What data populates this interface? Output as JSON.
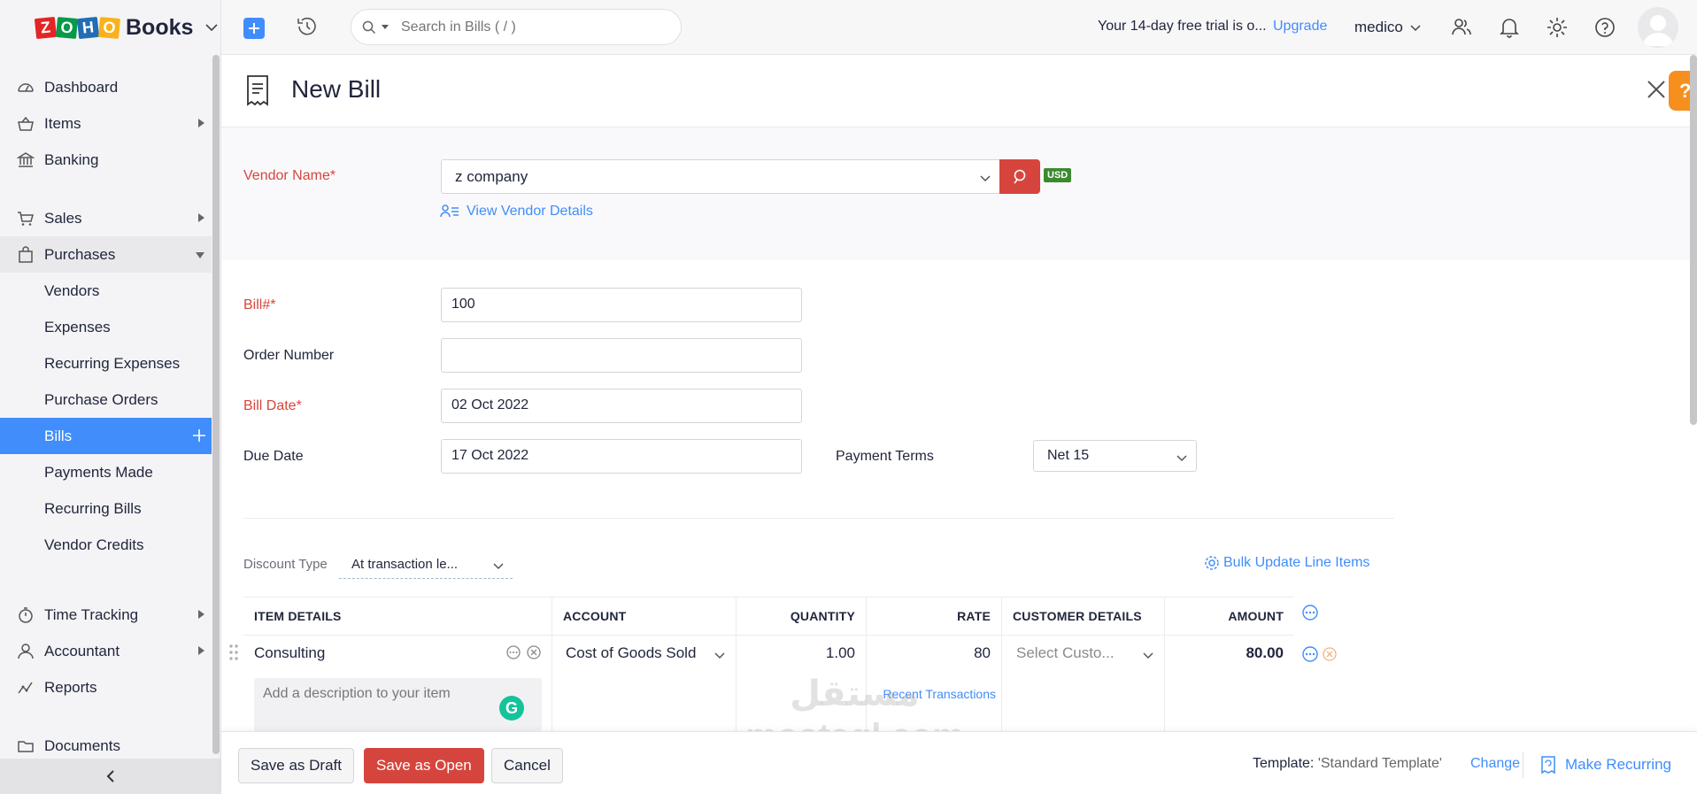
{
  "app": {
    "brand": "Books",
    "logo_letters": [
      "Z",
      "O",
      "H",
      "O"
    ],
    "logo_colors": [
      "#e42527",
      "#089949",
      "#226db4",
      "#f9b21d"
    ]
  },
  "header": {
    "search_placeholder": "Search in Bills ( / )",
    "trial_text": "Your 14-day free trial is o...",
    "upgrade_label": "Upgrade",
    "org_name": "medico"
  },
  "sidebar": {
    "dashboard": "Dashboard",
    "items": "Items",
    "banking": "Banking",
    "sales": "Sales",
    "purchases": "Purchases",
    "vendors": "Vendors",
    "expenses": "Expenses",
    "recurring_expenses": "Recurring Expenses",
    "purchase_orders": "Purchase Orders",
    "bills": "Bills",
    "payments_made": "Payments Made",
    "recurring_bills": "Recurring Bills",
    "vendor_credits": "Vendor Credits",
    "time_tracking": "Time Tracking",
    "accountant": "Accountant",
    "reports": "Reports",
    "documents": "Documents"
  },
  "page": {
    "title": "New Bill",
    "help": "?"
  },
  "form": {
    "vendor_label": "Vendor Name*",
    "vendor_value": "z company",
    "currency": "USD",
    "view_vendor": "View Vendor Details",
    "bill_no_label": "Bill#*",
    "bill_no_value": "100",
    "order_label": "Order Number",
    "order_value": "",
    "bill_date_label": "Bill Date*",
    "bill_date_value": "02 Oct 2022",
    "due_date_label": "Due Date",
    "due_date_value": "17 Oct 2022",
    "payment_terms_label": "Payment Terms",
    "payment_terms_value": "Net 15",
    "discount_label": "Discount Type",
    "discount_value": "At transaction le...",
    "bulk_update": "Bulk Update Line Items"
  },
  "table": {
    "headers": {
      "item": "ITEM DETAILS",
      "account": "ACCOUNT",
      "quantity": "QUANTITY",
      "rate": "RATE",
      "customer": "CUSTOMER DETAILS",
      "amount": "AMOUNT"
    },
    "rows": [
      {
        "item": "Consulting",
        "description_placeholder": "Add a description to your item",
        "account": "Cost of Goods Sold",
        "quantity": "1.00",
        "rate": "80",
        "recent": "Recent Transactions",
        "customer_placeholder": "Select Custo...",
        "amount": "80.00"
      }
    ]
  },
  "footer": {
    "save_draft": "Save as Draft",
    "save_open": "Save as Open",
    "cancel": "Cancel",
    "template_label": "Template:",
    "template_value": "'Standard Template'",
    "change": "Change",
    "make_recurring": "Make Recurring"
  },
  "watermark": {
    "line1": "مستقل",
    "line2": "mostaql.com"
  }
}
